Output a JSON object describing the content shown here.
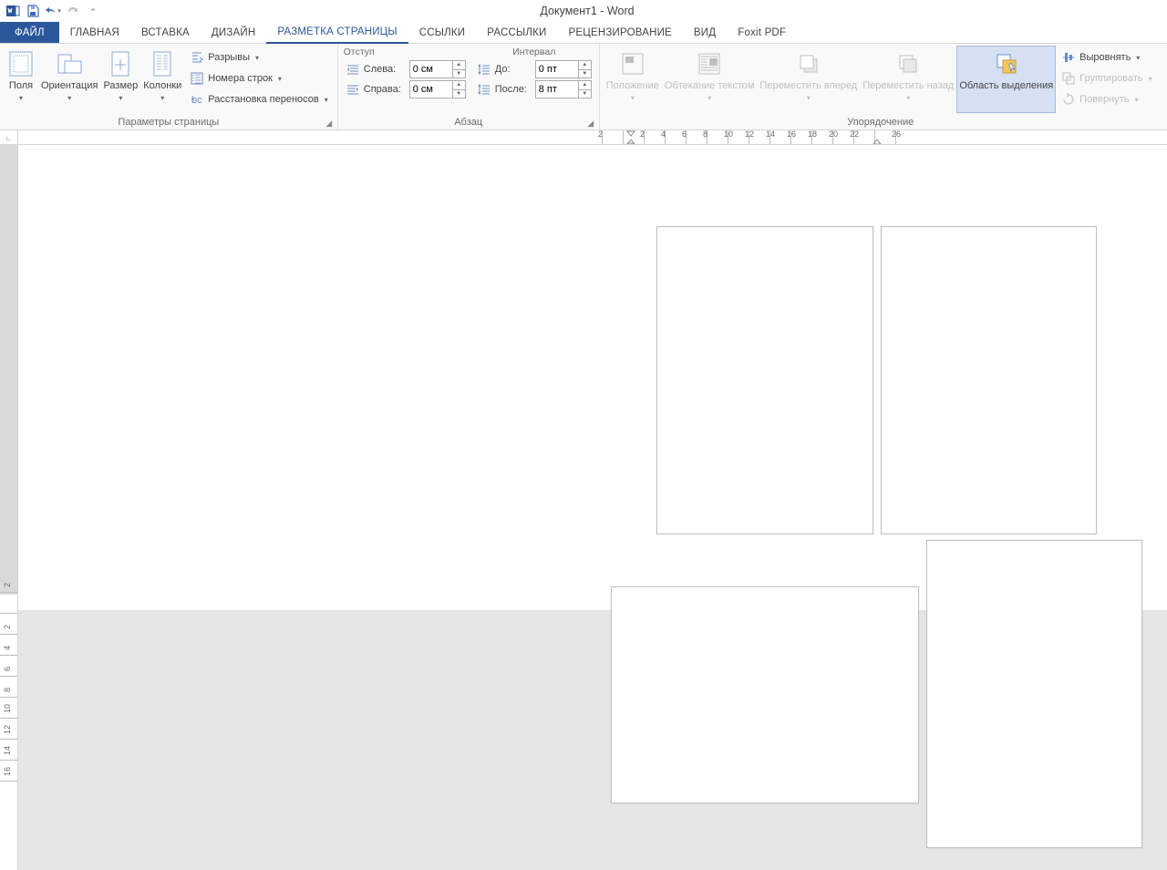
{
  "title": "Документ1 - Word",
  "tabs": {
    "file": "ФАЙЛ",
    "home": "ГЛАВНАЯ",
    "insert": "ВСТАВКА",
    "design": "ДИЗАЙН",
    "layout": "РАЗМЕТКА СТРАНИЦЫ",
    "references": "ССЫЛКИ",
    "mailings": "РАССЫЛКИ",
    "review": "РЕЦЕНЗИРОВАНИЕ",
    "view": "ВИД",
    "foxit": "Foxit PDF"
  },
  "groups": {
    "page_setup": {
      "title": "Параметры страницы",
      "margins": "Поля",
      "orientation": "Ориентация",
      "size": "Размер",
      "columns": "Колонки",
      "breaks": "Разрывы",
      "line_numbers": "Номера строк",
      "hyphenation": "Расстановка переносов"
    },
    "paragraph": {
      "title": "Абзац",
      "indent_heading": "Отступ",
      "spacing_heading": "Интервал",
      "left_label": "Слева:",
      "right_label": "Справа:",
      "before_label": "До:",
      "after_label": "После:",
      "left_value": "0 см",
      "right_value": "0 см",
      "before_value": "0 пт",
      "after_value": "8 пт"
    },
    "arrange": {
      "title": "Упорядочение",
      "position": "Положение",
      "wrap": "Обтекание текстом",
      "forward": "Переместить вперед",
      "backward": "Переместить назад",
      "selection": "Область выделения",
      "align": "Выровнять",
      "group": "Группировать",
      "rotate": "Повернуть"
    }
  },
  "ruler": {
    "h_numbers": [
      "2",
      "",
      "2",
      "4",
      "6",
      "8",
      "10",
      "12",
      "14",
      "16",
      "18",
      "20",
      "22",
      "",
      "26"
    ],
    "v_numbers": [
      "2",
      "",
      "2",
      "4",
      "6",
      "8",
      "10",
      "12",
      "14",
      "16"
    ]
  }
}
